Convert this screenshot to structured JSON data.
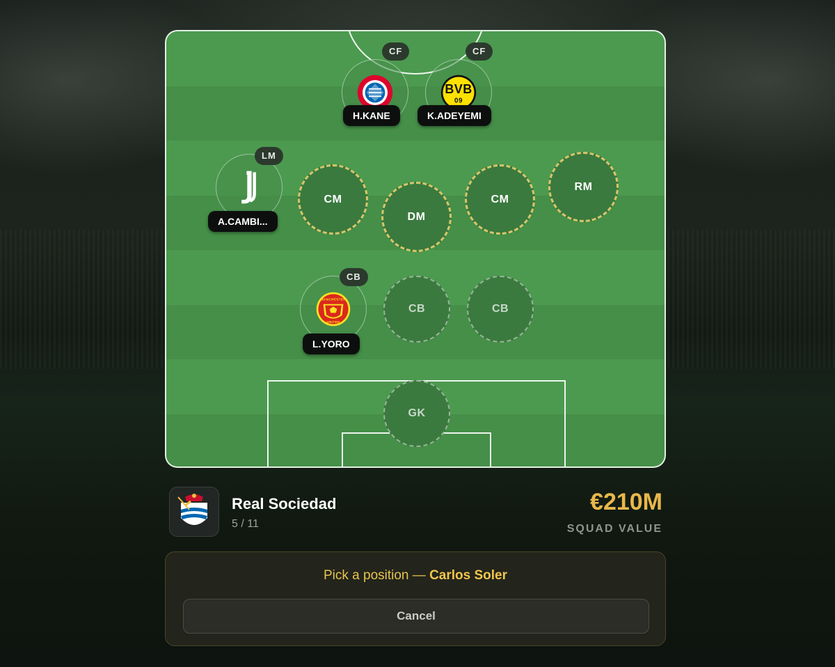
{
  "pitch": {
    "forwards": [
      {
        "position": "CF",
        "player": "H.KANE",
        "club_icon": "bayern-munich-crest-icon"
      },
      {
        "position": "CF",
        "player": "K.ADEYEMI",
        "club_icon": "borussia-dortmund-crest-icon"
      }
    ],
    "midfield": [
      {
        "position": "LM",
        "player": "A.CAMBI...",
        "club_icon": "juventus-crest-icon"
      },
      {
        "position": "CM",
        "state": "highlighted-empty"
      },
      {
        "position": "DM",
        "state": "highlighted-empty"
      },
      {
        "position": "CM",
        "state": "highlighted-empty"
      },
      {
        "position": "RM",
        "state": "highlighted-empty"
      }
    ],
    "defense": [
      {
        "position": "CB",
        "player": "L.YORO",
        "club_icon": "manchester-united-crest-icon"
      },
      {
        "position": "CB",
        "state": "empty"
      },
      {
        "position": "CB",
        "state": "empty"
      }
    ],
    "goalkeeper": {
      "position": "GK",
      "state": "empty"
    }
  },
  "team": {
    "name": "Real Sociedad",
    "count": "5 / 11",
    "logo_icon": "real-sociedad-crest-icon",
    "squad_value": "€210M",
    "squad_value_label": "SQUAD VALUE"
  },
  "pick": {
    "prefix": "Pick a position — ",
    "player": "Carlos Soler",
    "cancel_label": "Cancel"
  },
  "colors": {
    "accent_gold": "#e8b84a",
    "highlight_ring": "#d8c56a",
    "pitch_green": "#4c9a4f"
  }
}
